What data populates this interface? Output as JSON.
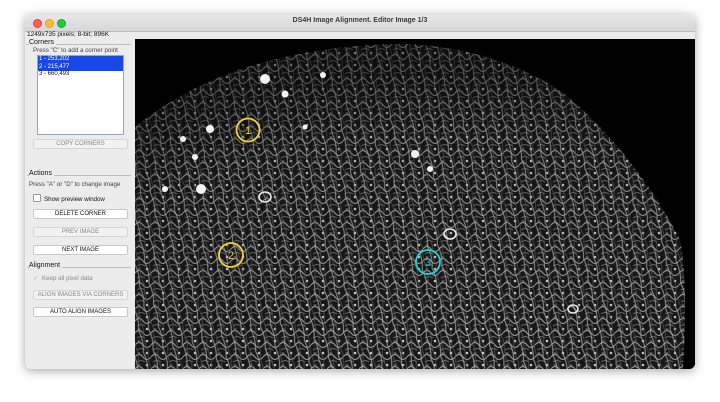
{
  "window": {
    "title": "DS4H Image Alignment. Editor Image 1/3"
  },
  "status": {
    "image_info": "1249x735 pixels; 8-bit; 896K"
  },
  "corners": {
    "heading": "Corners",
    "hint": "Press \"C\" to add a corner point",
    "items": [
      {
        "label": "1 - 253,202",
        "selected": true
      },
      {
        "label": "2 - 215,477",
        "selected": true
      },
      {
        "label": "3 - 660,493",
        "selected": false
      }
    ],
    "copy_button": "COPY CORNERS"
  },
  "actions": {
    "heading": "Actions",
    "hint": "Press \"A\" or \"D\" to change image",
    "show_preview_label": "Show preview window",
    "show_preview_checked": false,
    "delete_button": "DELETE CORNER",
    "prev_button": "PREV IMAGE",
    "next_button": "NEXT IMAGE"
  },
  "alignment": {
    "heading": "Alignment",
    "keep_pixel_label": "Keep all pixel data",
    "keep_pixel_checked": true,
    "align_corners_button": "ALIGN IMAGES VIA CORNERS",
    "auto_align_button": "AUTO ALIGN IMAGES"
  },
  "markers": [
    {
      "label": "1",
      "color": "#f2d43a"
    },
    {
      "label": "2",
      "color": "#f2d43a"
    },
    {
      "label": "3",
      "color": "#1fd3d8"
    }
  ],
  "colors": {
    "selection": "#1a47e8",
    "marker_selected": "#f2d43a",
    "marker_unselected": "#1fd3d8"
  }
}
